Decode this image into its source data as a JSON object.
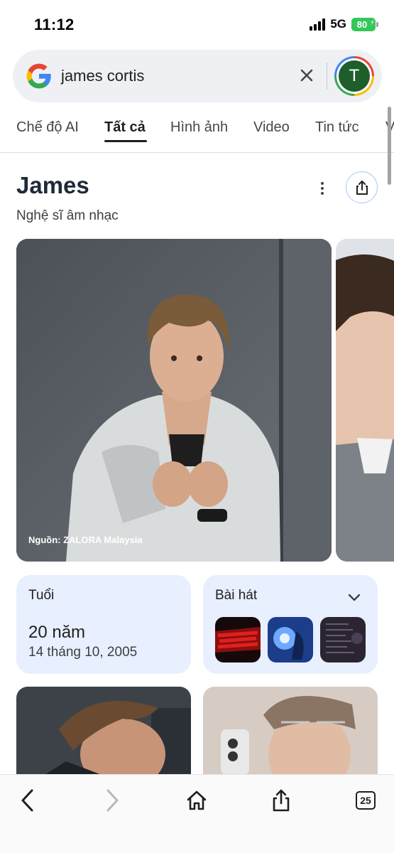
{
  "status": {
    "time": "11:12",
    "network": "5G",
    "battery": "80"
  },
  "search": {
    "query": "james cortis",
    "avatar_letter": "T"
  },
  "tabs": [
    {
      "label": "Chế độ AI",
      "active": false
    },
    {
      "label": "Tất cả",
      "active": true
    },
    {
      "label": "Hình ảnh",
      "active": false
    },
    {
      "label": "Video",
      "active": false
    },
    {
      "label": "Tin tức",
      "active": false
    },
    {
      "label": "V",
      "active": false
    }
  ],
  "knowledge_panel": {
    "title": "James",
    "subtitle": "Nghệ sĩ âm nhạc",
    "main_photo_source": "Nguồn: ZALORA Malaysia"
  },
  "cards": {
    "age": {
      "label": "Tuổi",
      "value": "20 năm",
      "date": "14 tháng 10, 2005"
    },
    "songs": {
      "label": "Bài hát",
      "thumbs": [
        "song-cover-redrum",
        "song-cover-blue-light",
        "song-cover-tracklist"
      ]
    }
  },
  "toolbar": {
    "tab_count": "25"
  },
  "colors": {
    "card_bg": "#e8efff",
    "accent_blue": "#1a73e8",
    "battery_green": "#34c759"
  }
}
